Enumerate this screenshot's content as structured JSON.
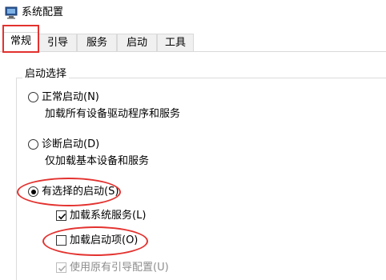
{
  "window": {
    "title": "系统配置",
    "icon": "msconfig-icon"
  },
  "tabs": [
    {
      "label": "常规",
      "active": true
    },
    {
      "label": "引导",
      "active": false
    },
    {
      "label": "服务",
      "active": false
    },
    {
      "label": "启动",
      "active": false
    },
    {
      "label": "工具",
      "active": false
    }
  ],
  "startup_selection": {
    "group_title": "启动选择",
    "normal": {
      "label": "正常启动(N)",
      "description": "加载所有设备驱动程序和服务",
      "selected": false
    },
    "diagnostic": {
      "label": "诊断启动(D)",
      "description": "仅加载基本设备和服务",
      "selected": false
    },
    "selective": {
      "label": "有选择的启动(S)",
      "selected": true,
      "options": {
        "load_system_services": {
          "label": "加载系统服务(L)",
          "checked": true,
          "enabled": true
        },
        "load_startup_items": {
          "label": "加载启动项(O)",
          "checked": false,
          "enabled": true
        },
        "use_original_boot_config": {
          "label": "使用原有引导配置(U)",
          "checked": true,
          "enabled": false
        }
      }
    }
  },
  "annotation_color": "#e3322f"
}
